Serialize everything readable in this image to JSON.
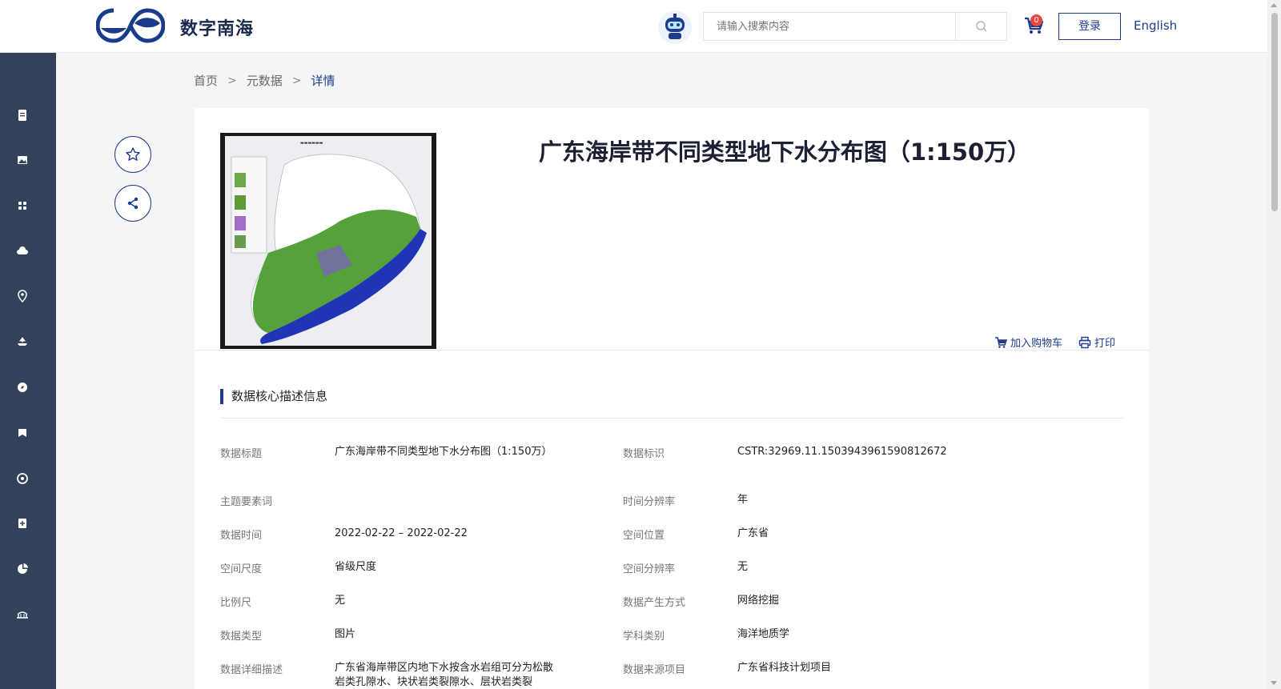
{
  "header": {
    "brand": "数字南海",
    "search_placeholder": "请输入搜索内容",
    "cart_count": "0",
    "login_label": "登录",
    "lang_label": "English"
  },
  "breadcrumb": {
    "home": "首页",
    "metadata": "元数据",
    "current": "详情"
  },
  "dataset": {
    "title": "广东海岸带不同类型地下水分布图（1:150万）",
    "add_to_cart": "加入购物车",
    "print": "打印"
  },
  "section": {
    "title": "数据核心描述信息"
  },
  "fields": {
    "left": [
      {
        "label": "数据标题",
        "value": "广东海岸带不同类型地下水分布图（1:150万）"
      },
      {
        "label": "主题要素词",
        "value": ""
      },
      {
        "label": "数据时间",
        "value": "2022-02-22 – 2022-02-22"
      },
      {
        "label": "空间尺度",
        "value": "省级尺度"
      },
      {
        "label": "比例尺",
        "value": "无"
      },
      {
        "label": "数据类型",
        "value": "图片"
      },
      {
        "label": "数据详细描述",
        "value": "广东省海岸带区内地下水按含水岩组可分为松散岩类孔隙水、块状岩类裂隙水、层状岩类裂"
      }
    ],
    "right": [
      {
        "label": "数据标识",
        "value": "CSTR:32969.11.1503943961590812672"
      },
      {
        "label": "时间分辨率",
        "value": "年"
      },
      {
        "label": "空间位置",
        "value": "广东省"
      },
      {
        "label": "空间分辨率",
        "value": "无"
      },
      {
        "label": "数据产生方式",
        "value": "网络挖掘"
      },
      {
        "label": "学科类别",
        "value": "海洋地质学"
      },
      {
        "label": "数据来源项目",
        "value": "广东省科技计划项目"
      }
    ]
  },
  "sidebar": {
    "icons": [
      "document-icon",
      "image-icon",
      "grid-icon",
      "cloud-icon",
      "location-pin-icon",
      "ship-icon",
      "compass-icon",
      "bookmark-icon",
      "target-icon",
      "add-document-icon",
      "pie-chart-icon",
      "bridge-icon"
    ]
  },
  "colors": {
    "accent": "#1e3a8a",
    "sidebar": "#34415a",
    "badge": "#f0453a"
  }
}
